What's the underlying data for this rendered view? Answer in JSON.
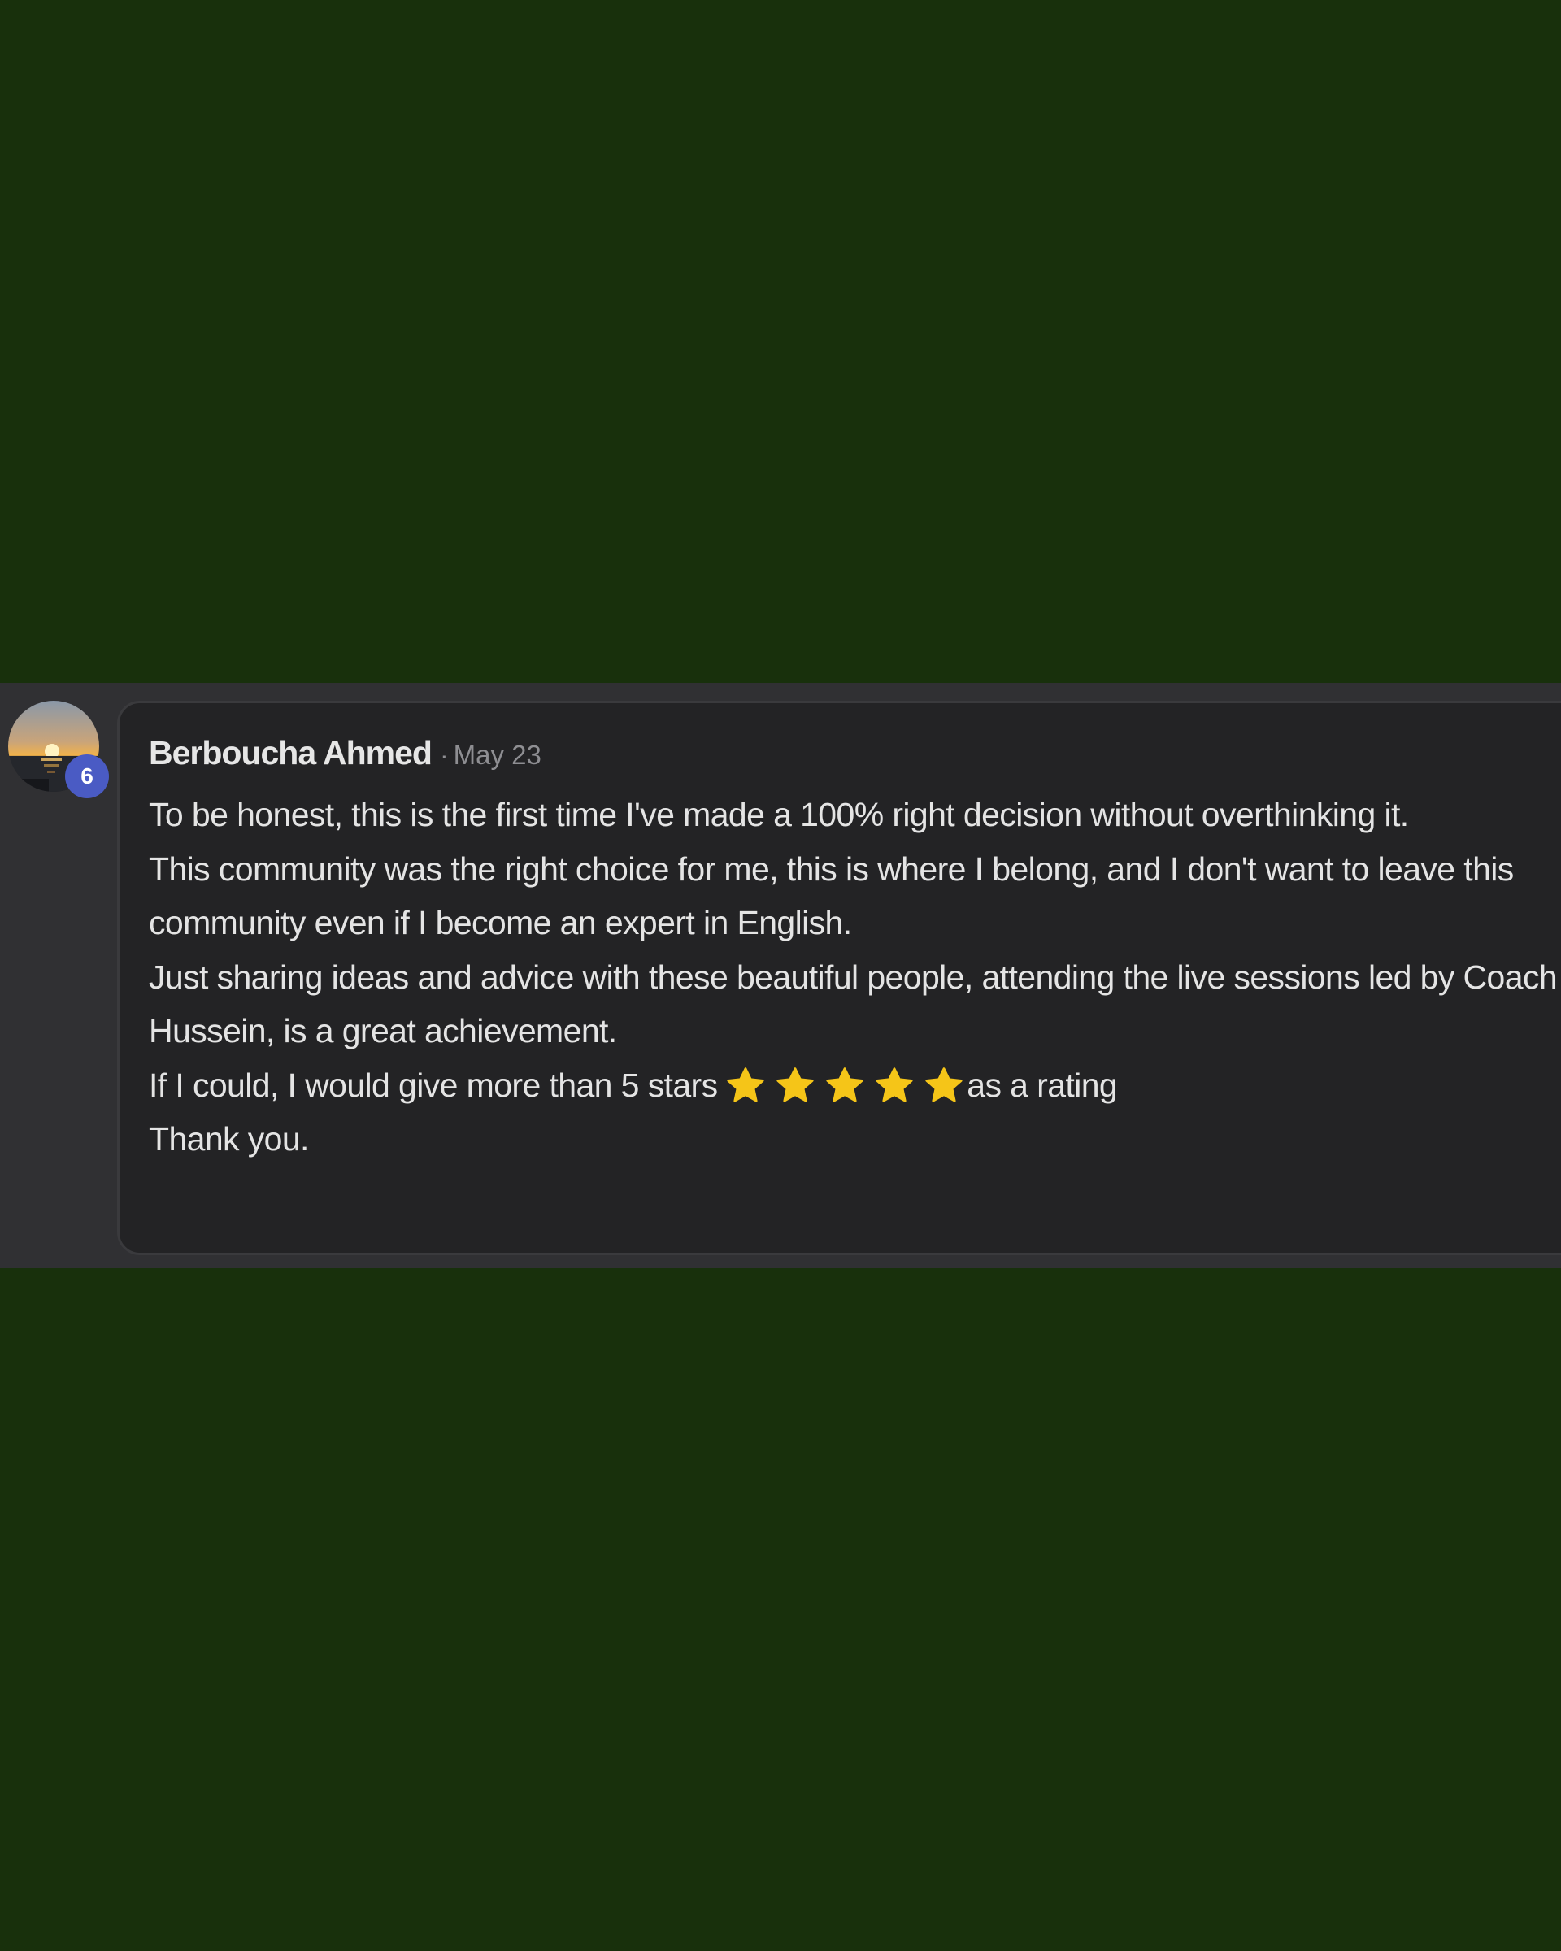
{
  "post": {
    "author": "Berboucha Ahmed",
    "separator": "·",
    "date": "May 23",
    "level": "6",
    "avatar_icon": "sunset-photo-avatar",
    "star_color": "#f5c518",
    "rating_stars_shown": 5,
    "paragraphs": {
      "p1": "To be honest, this is the first time I've made a 100% right decision without overthinking it.",
      "p2": "This community was the right choice for me, this is where I belong, and I don't want to leave this community even if I become an expert in English.",
      "p3": "Just sharing ideas and advice with these beautiful people, attending the live sessions led by Coach Hussein, is a great achievement.",
      "p4_before": "If I could, I would give more than 5 stars ",
      "p4_after": "as a rating",
      "p5": "Thank you."
    }
  },
  "colors": {
    "page_background": "#18300c",
    "band_background": "#303033",
    "card_background": "#232325",
    "badge_background": "#4a5bc4"
  }
}
